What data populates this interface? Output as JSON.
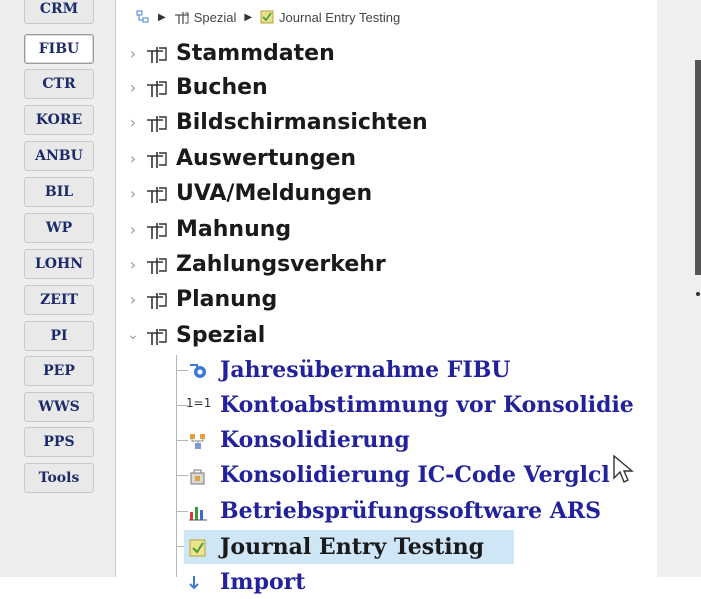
{
  "modules": [
    {
      "label": "CRM"
    },
    {
      "label": "FIBU",
      "active": true
    },
    {
      "label": "CTR"
    },
    {
      "label": "KORE"
    },
    {
      "label": "ANBU"
    },
    {
      "label": "BIL"
    },
    {
      "label": "WP"
    },
    {
      "label": "LOHN"
    },
    {
      "label": "ZEIT"
    },
    {
      "label": "PI"
    },
    {
      "label": "PEP"
    },
    {
      "label": "WWS"
    },
    {
      "label": "PPS"
    },
    {
      "label": "Tools"
    }
  ],
  "breadcrumb": {
    "parent": "Spezial",
    "current": "Journal Entry Testing"
  },
  "tree": {
    "folders": [
      {
        "label": "Stammdaten",
        "expanded": false
      },
      {
        "label": "Buchen",
        "expanded": false
      },
      {
        "label": "Bildschirmansichten",
        "expanded": false
      },
      {
        "label": "Auswertungen",
        "expanded": false
      },
      {
        "label": "UVA/Meldungen",
        "expanded": false
      },
      {
        "label": "Mahnung",
        "expanded": false
      },
      {
        "label": "Zahlungsverkehr",
        "expanded": false
      },
      {
        "label": "Planung",
        "expanded": false
      },
      {
        "label": "Spezial",
        "expanded": true
      }
    ],
    "children": [
      {
        "label": "Jahresübernahme FIBU",
        "icon": "transfer-icon"
      },
      {
        "label": "Kontoabstimmung vor Konsolidie",
        "icon": "one-to-one-icon",
        "icon_text": "1=1"
      },
      {
        "label": "Konsolidierung",
        "icon": "consolidation-icon"
      },
      {
        "label": "Konsolidierung IC-Code Verglcl",
        "icon": "compare-icon"
      },
      {
        "label": "Betriebsprüfungssoftware ARS",
        "icon": "bar-chart-icon"
      },
      {
        "label": "Journal Entry Testing",
        "icon": "journal-icon",
        "selected": true
      },
      {
        "label": "Import",
        "icon": "import-icon"
      }
    ]
  },
  "colors": {
    "module_text": "#1b2b6b",
    "child_text": "#22229a",
    "selection": "#cfe6f7"
  }
}
